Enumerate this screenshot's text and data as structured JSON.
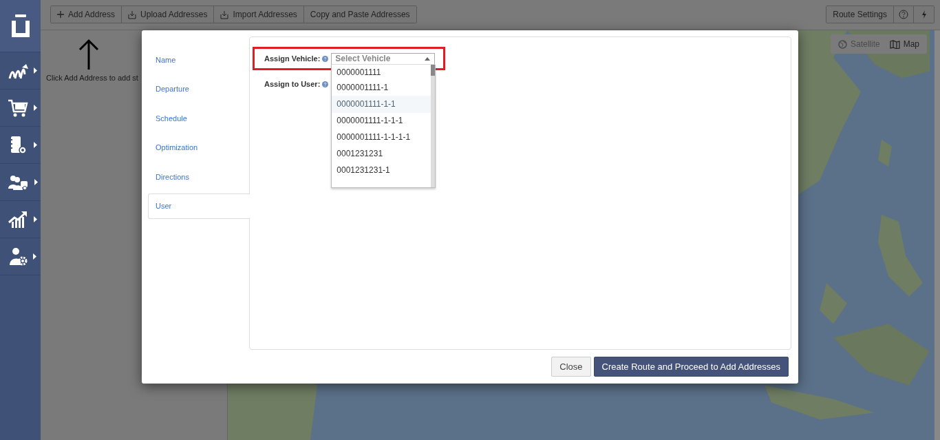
{
  "sidebar": {
    "items": [
      {
        "kind": "logo",
        "expandable": false
      },
      {
        "kind": "routes",
        "expandable": true
      },
      {
        "kind": "cart",
        "expandable": true
      },
      {
        "kind": "notebook",
        "expandable": true
      },
      {
        "kind": "team",
        "expandable": true
      },
      {
        "kind": "chart",
        "expandable": true
      },
      {
        "kind": "user-settings",
        "expandable": true
      }
    ]
  },
  "toolbar": {
    "buttons": [
      {
        "label": "Add Address",
        "kind": "add"
      },
      {
        "label": "Upload Addresses",
        "kind": "upload"
      },
      {
        "label": "Import Addresses",
        "kind": "upload"
      },
      {
        "label": "Copy and Paste Addresses",
        "kind": "text"
      }
    ],
    "right_buttons": [
      {
        "kind": "text",
        "label": "Route Settings"
      },
      {
        "kind": "help"
      },
      {
        "kind": "bolt"
      }
    ]
  },
  "empty_hint": "Click Add Address to add st",
  "map": {
    "kind": "picture",
    "map_types": [
      {
        "label": "Satellite",
        "selected": false
      },
      {
        "label": "Map",
        "selected": true
      }
    ]
  },
  "modal": {
    "tabs": [
      {
        "label": "Name",
        "selected": false
      },
      {
        "label": "Departure",
        "selected": false
      },
      {
        "label": "Schedule",
        "selected": false
      },
      {
        "label": "Optimization",
        "selected": false
      },
      {
        "label": "Directions",
        "selected": false
      },
      {
        "label": "User",
        "selected": true
      }
    ],
    "fields": [
      {
        "label": "Assign Vehicle:",
        "highlighted": true,
        "placeholder": "Select Vehicle",
        "open": true,
        "options": [
          {
            "label": "0000001111",
            "hovered": false
          },
          {
            "label": "0000001111-1",
            "hovered": false
          },
          {
            "label": "0000001111-1-1",
            "hovered": true
          },
          {
            "label": "0000001111-1-1-1",
            "hovered": false
          },
          {
            "label": "0000001111-1-1-1-1",
            "hovered": false
          },
          {
            "label": "0001231231",
            "hovered": false
          },
          {
            "label": "0001231231-1",
            "hovered": false
          }
        ]
      },
      {
        "label": "Assign to User:"
      }
    ],
    "buttons": [
      {
        "label": "Close",
        "kind": "secondary"
      },
      {
        "label": "Create Route and Proceed to Add Addresses",
        "kind": "primary"
      }
    ]
  }
}
